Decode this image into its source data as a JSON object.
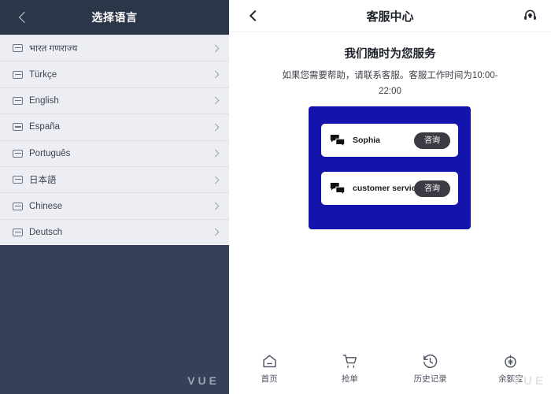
{
  "language_panel": {
    "header": {
      "title": "选择语言",
      "back_icon": "chevron-left-icon"
    },
    "items": [
      {
        "label": "भारत गणराज्य"
      },
      {
        "label": "Türkçe"
      },
      {
        "label": "English"
      },
      {
        "label": "España"
      },
      {
        "label": "Português"
      },
      {
        "label": "日本語"
      },
      {
        "label": "Chinese"
      },
      {
        "label": "Deutsch"
      }
    ],
    "watermark": "VUE",
    "colors": {
      "header_bg": "#2b3648",
      "panel_bg": "#344158",
      "row_bg": "#eceef3"
    }
  },
  "service_panel": {
    "header": {
      "title": "客服中心",
      "back_icon": "chevron-left-icon",
      "headset_icon": "headset-icon"
    },
    "intro": {
      "title": "我们随时为您服务",
      "description": "如果您需要帮助，请联系客服。客服工作时间为10:00-22:00"
    },
    "card": {
      "background": "#1414ab",
      "agents": [
        {
          "name": "Sophia",
          "icon": "chat-bubbles-icon",
          "action_label": "咨询"
        },
        {
          "name": "customer service",
          "icon": "chat-bubbles-icon",
          "action_label": "咨询"
        }
      ]
    },
    "tabbar": [
      {
        "label": "首页",
        "icon": "home-icon"
      },
      {
        "label": "抢单",
        "icon": "cart-icon"
      },
      {
        "label": "历史记录",
        "icon": "history-clock-icon"
      },
      {
        "label": "余额宝",
        "icon": "wallet-coin-icon"
      }
    ],
    "watermark": "VUE"
  }
}
